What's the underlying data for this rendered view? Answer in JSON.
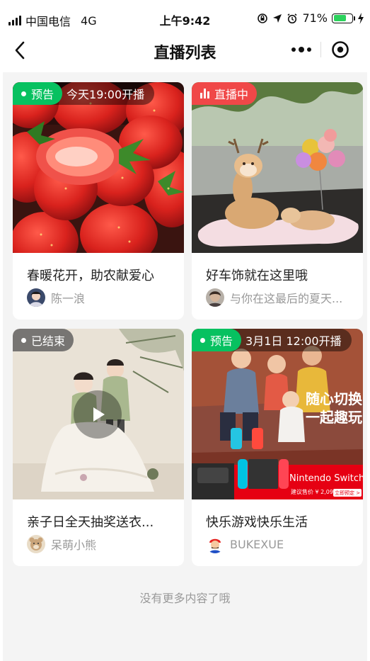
{
  "status_bar": {
    "carrier": "中国电信",
    "network": "4G",
    "time": "上午9:42",
    "battery": "71%",
    "battery_level": 0.71
  },
  "nav": {
    "title": "直播列表"
  },
  "colors": {
    "upcoming_green": "#07c160",
    "live_red": "#f04848",
    "ended_gray": "#6f6f6f"
  },
  "cards": [
    {
      "status": "预告",
      "status_type": "upcoming",
      "schedule": "今天19:00开播",
      "title": "春暖花开，助农献爱心",
      "author": "陈一浪"
    },
    {
      "status": "直播中",
      "status_type": "live",
      "title": "好车饰就在这里哦",
      "author": "与你在这最后的夏天..."
    },
    {
      "status": "已结束",
      "status_type": "ended",
      "title": "亲子日全天抽奖送衣...",
      "author": "呆萌小熊"
    },
    {
      "status": "预告",
      "status_type": "upcoming",
      "schedule": "3月1日 12:00开播",
      "title": "快乐游戏快乐生活",
      "author": "BUKEXUE",
      "image_text": {
        "line1": "随心切换",
        "line2": "一起趣玩",
        "brand": "Nintendo Switch",
        "price": "建议售价 ¥ 2,099",
        "cta": "立即预定 >"
      }
    }
  ],
  "footer": {
    "note": "没有更多内容了哦"
  }
}
